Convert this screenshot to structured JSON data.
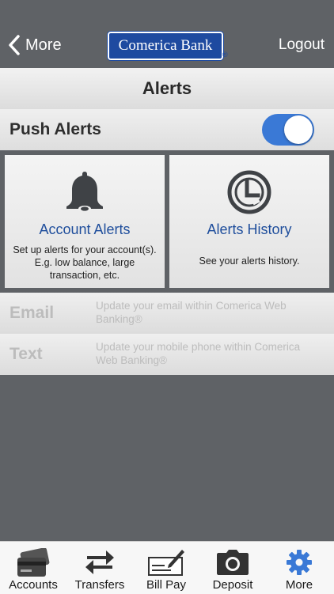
{
  "header": {
    "back_label": "More",
    "logo_text": "Comerica Bank",
    "logo_reg": "®",
    "logout_label": "Logout"
  },
  "page": {
    "title": "Alerts"
  },
  "push": {
    "label": "Push Alerts",
    "enabled": true
  },
  "cards": {
    "account": {
      "title": "Account Alerts",
      "description": "Set up alerts for your account(s). E.g. low balance, large transaction, etc.",
      "icon": "bell-icon"
    },
    "history": {
      "title": "Alerts History",
      "description": "See your alerts history.",
      "icon": "clock-history-icon"
    }
  },
  "rows": {
    "email": {
      "label": "Email",
      "description": "Update your email within Comerica Web Banking®"
    },
    "text": {
      "label": "Text",
      "description": "Update your mobile phone within Comerica Web Banking®"
    }
  },
  "tabs": [
    {
      "label": "Accounts",
      "icon": "cards-icon"
    },
    {
      "label": "Transfers",
      "icon": "transfer-arrows-icon"
    },
    {
      "label": "Bill Pay",
      "icon": "check-pen-icon"
    },
    {
      "label": "Deposit",
      "icon": "camera-icon"
    },
    {
      "label": "More",
      "icon": "gear-icon",
      "active": true
    }
  ],
  "colors": {
    "brand_blue": "#1e4aa0",
    "toggle_on": "#3a79d6",
    "active_tab": "#3a79d6",
    "card_title": "#1f4e9c"
  }
}
